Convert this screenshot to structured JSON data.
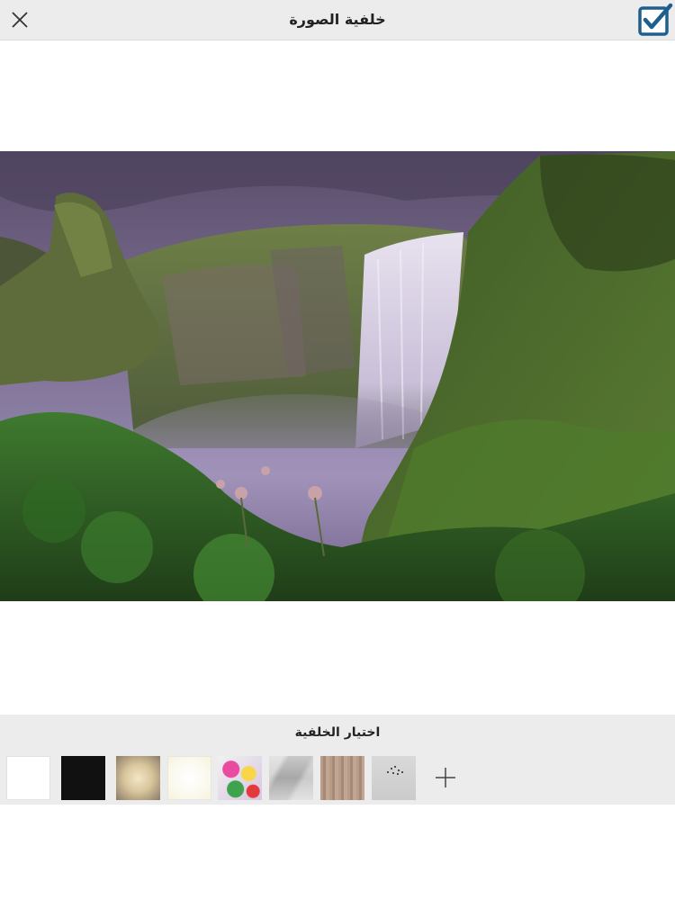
{
  "header": {
    "title": "خلفية الصورة",
    "close_icon": "close-icon",
    "confirm_icon": "checkbox-check-icon",
    "accent_color": "#1e5f8e"
  },
  "photo": {
    "description_icon": "waterfall-landscape-photo"
  },
  "background_picker": {
    "label": "اختيار الخلفية",
    "swatches": [
      "white",
      "black",
      "vignette",
      "cream",
      "floral",
      "marble",
      "wood",
      "snow"
    ],
    "add_icon": "plus-icon"
  }
}
